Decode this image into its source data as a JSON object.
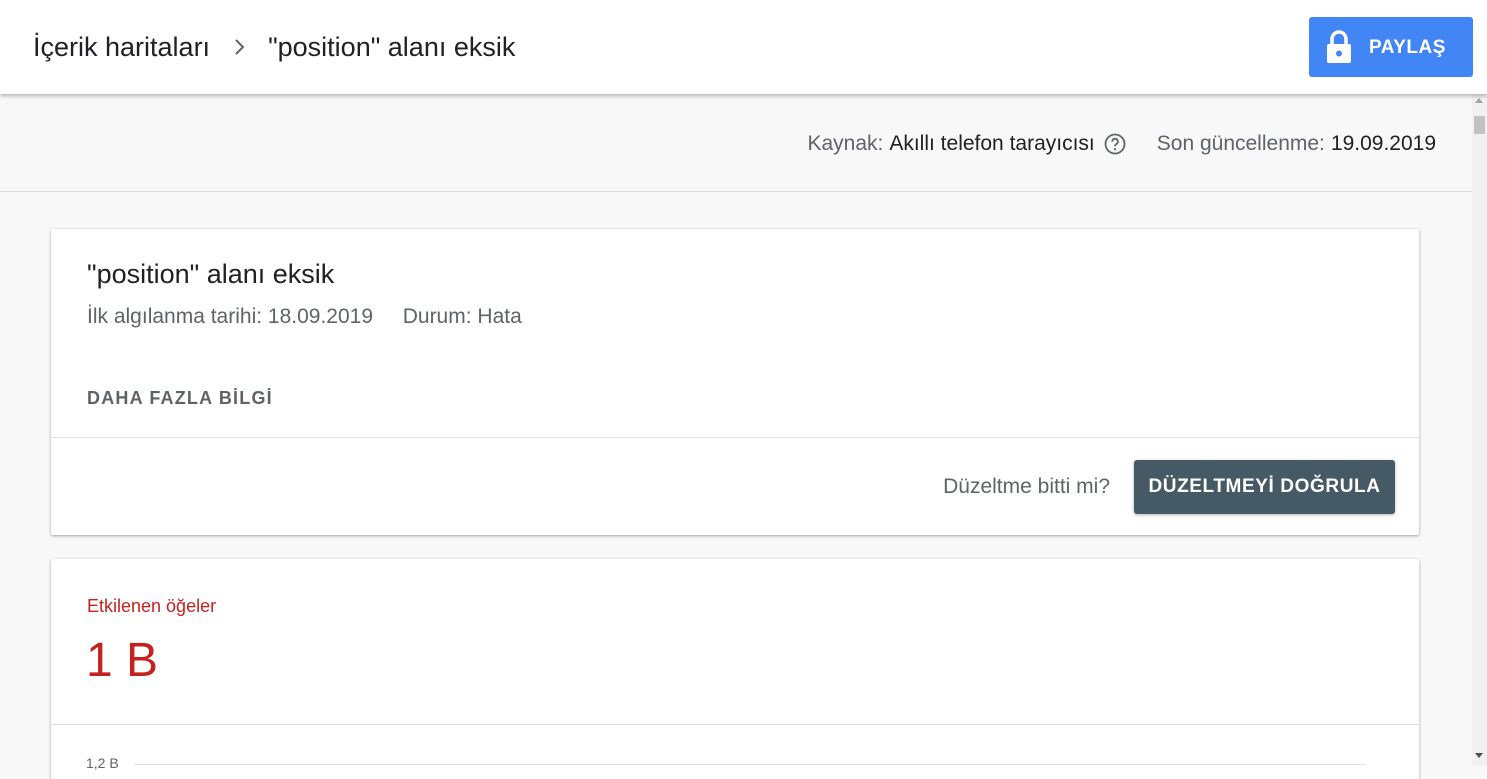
{
  "header": {
    "breadcrumb_parent": "İçerik haritaları",
    "breadcrumb_current": "\"position\" alanı eksik",
    "share_label": "PAYLAŞ",
    "share_color": "#4285f4"
  },
  "meta": {
    "source_key": "Kaynak:",
    "source_value": "Akıllı telefon tarayıcısı",
    "updated_key": "Son güncellenme:",
    "updated_value": "19.09.2019"
  },
  "issue_card": {
    "title": "\"position\" alanı eksik",
    "first_detected_key": "İlk algılanma tarihi:",
    "first_detected_value": "18.09.2019",
    "status_key": "Durum:",
    "status_value": "Hata",
    "more_info_label": "DAHA FAZLA BİLGİ",
    "fix_question": "Düzeltme bitti mi?",
    "verify_label": "DÜZELTMEYİ DOĞRULA",
    "verify_color": "#455a64"
  },
  "affected_card": {
    "label": "Etkilenen öğeler",
    "value": "1 B",
    "accent_color": "#c5221f",
    "chart_tick_top": "1,2 B"
  }
}
